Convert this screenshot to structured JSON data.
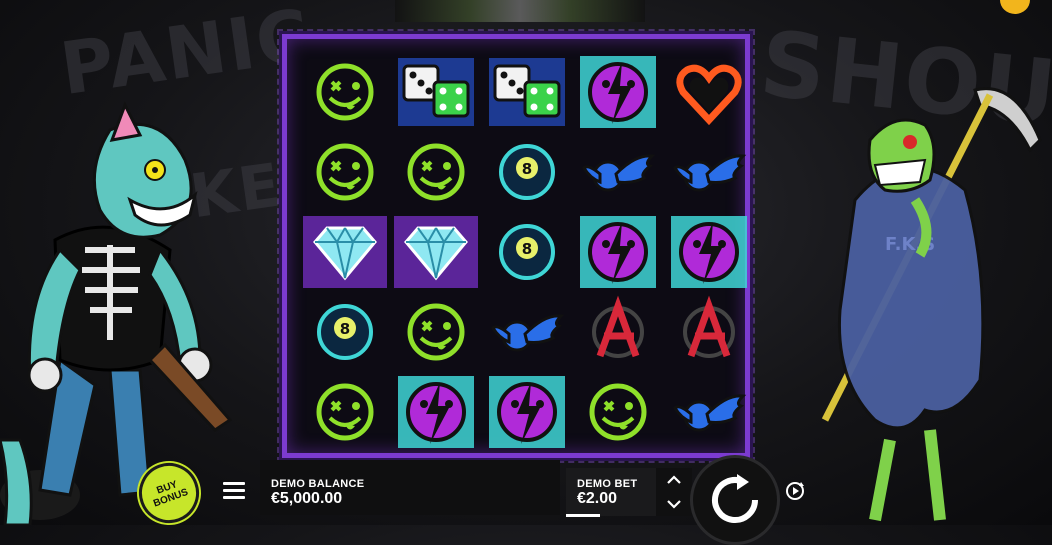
{
  "background": {
    "graffiti": [
      "PANIC",
      "SHOUT",
      "KEYS"
    ]
  },
  "board": {
    "rows": [
      [
        "smiley-x-green",
        "dice",
        "dice",
        "smiley-bolt-purple",
        "heart-orange"
      ],
      [
        "smiley-x-green",
        "smiley-x-green",
        "eight-ball",
        "wing-blue",
        "wing-blue"
      ],
      [
        "diamond",
        "diamond",
        "eight-ball",
        "smiley-bolt-purple",
        "smiley-bolt-purple"
      ],
      [
        "eight-ball",
        "smiley-x-green",
        "wing-blue",
        "anarchy-red",
        "anarchy-red"
      ],
      [
        "smiley-x-green",
        "smiley-bolt-purple",
        "smiley-bolt-purple",
        "smiley-x-green",
        "wing-blue"
      ]
    ]
  },
  "controls": {
    "buy_bonus": {
      "line1": "BUY",
      "line2": "BONUS"
    },
    "balance_label": "DEMO BALANCE",
    "balance_value": "€5,000.00",
    "bet_label": "DEMO BET",
    "bet_value": "€2.00",
    "icons": {
      "menu": "menu-icon",
      "bet_up": "chevron-up-icon",
      "bet_down": "chevron-down-icon",
      "spin": "spin-icon",
      "autoplay": "autoplay-icon"
    }
  },
  "colors": {
    "frame": "#7c3bd1",
    "green": "#8fe02a",
    "purple": "#b02ad8",
    "cyan": "#3fd6d6",
    "blue": "#2a6ee8",
    "red": "#d8283a",
    "buy": "#c7e62a"
  }
}
